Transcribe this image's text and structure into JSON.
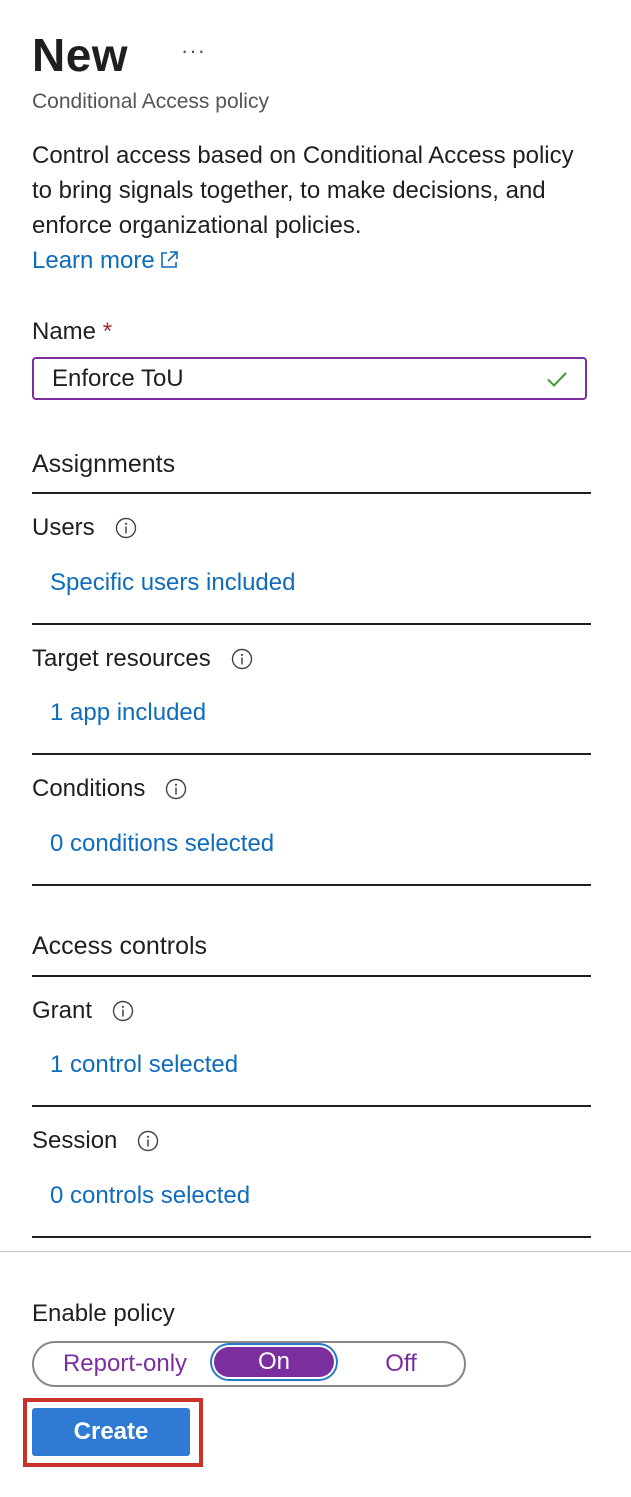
{
  "header": {
    "title": "New",
    "more_label": "···",
    "subtitle": "Conditional Access policy"
  },
  "description": {
    "text": "Control access based on Conditional Access policy to bring signals together, to make decisions, and enforce organizational policies.",
    "learn_more": "Learn more"
  },
  "name_field": {
    "label": "Name",
    "required_mark": "*",
    "value": "Enforce ToU",
    "valid_icon": "checkmark-icon"
  },
  "assignments": {
    "heading": "Assignments",
    "users": {
      "label": "Users",
      "value": "Specific users included"
    },
    "target_resources": {
      "label": "Target resources",
      "value": "1 app included"
    },
    "conditions": {
      "label": "Conditions",
      "value": "0 conditions selected"
    }
  },
  "access_controls": {
    "heading": "Access controls",
    "grant": {
      "label": "Grant",
      "value": "1 control selected"
    },
    "session": {
      "label": "Session",
      "value": "0 controls selected"
    }
  },
  "enable_policy": {
    "label": "Enable policy",
    "options": [
      "Report-only",
      "On",
      "Off"
    ],
    "selected": "On"
  },
  "footer": {
    "create_label": "Create"
  },
  "colors": {
    "accent_purple": "#7b2f9f",
    "link_blue": "#0f6cbd",
    "button_blue": "#2f7bd4",
    "highlight_red": "#c9312b",
    "success_green": "#3c9a2e"
  }
}
